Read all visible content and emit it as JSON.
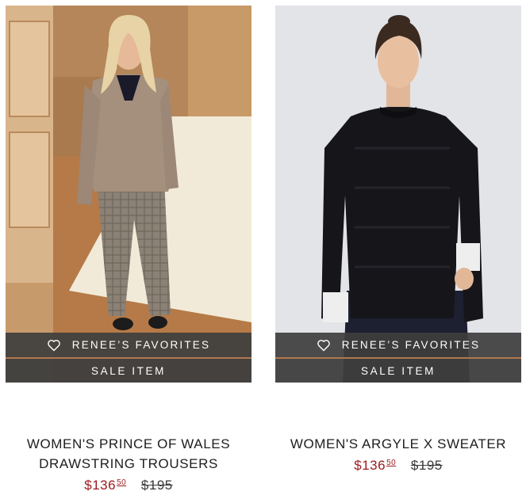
{
  "products": [
    {
      "image_alt": "",
      "favorites_label": "RENEE’S FAVORITES",
      "sale_label": "SALE ITEM",
      "title_line1": "WOMEN'S PRINCE OF WALES",
      "title_line2": "DRAWSTRING TROUSERS",
      "price_dollars": "$136",
      "price_cents": "50",
      "original_price": "$195"
    },
    {
      "image_alt": "",
      "favorites_label": "RENEE’S FAVORITES",
      "sale_label": "SALE ITEM",
      "title_line1": "WOMEN'S ARGYLE X SWEATER",
      "title_line2": "",
      "price_dollars": "$136",
      "price_cents": "50",
      "original_price": "$195"
    }
  ],
  "colors": {
    "badge_bg": "#3e3e3e",
    "badge_divider": "#b0784e",
    "sale_price": "#9b1a1e",
    "title_text": "#1e1e1e"
  },
  "icons": {
    "favorites": "heart-outline-icon"
  }
}
